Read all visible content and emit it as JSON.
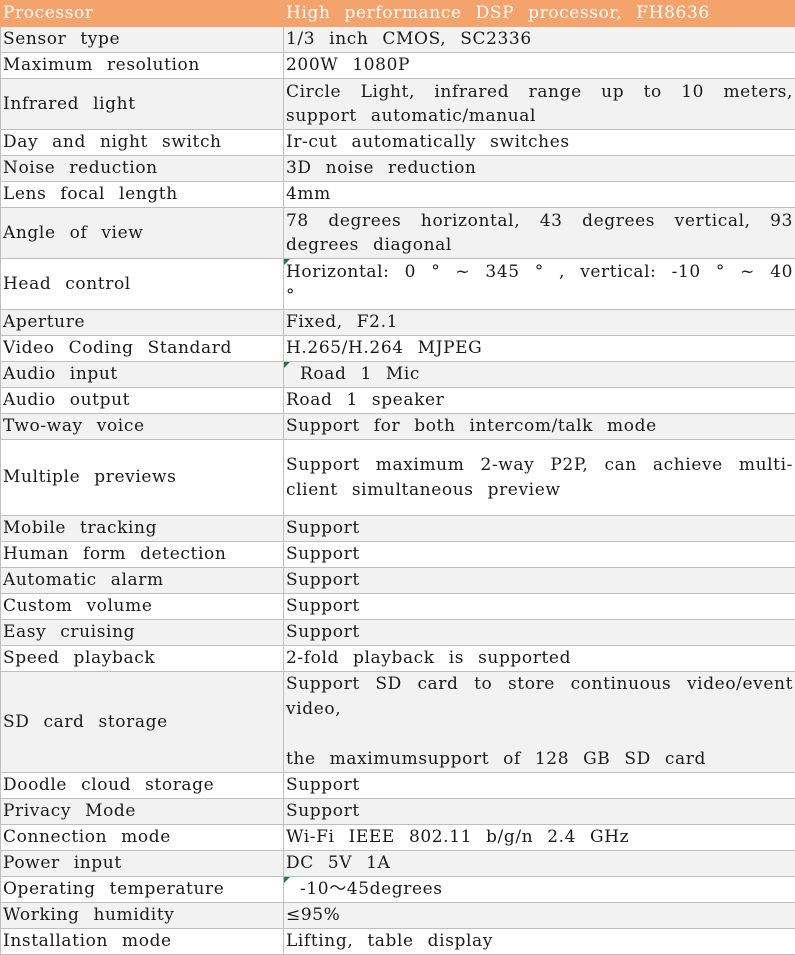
{
  "header": {
    "label": "Processor",
    "value": "High performance DSP processor, FH8636"
  },
  "rows": [
    {
      "label": "Sensor type",
      "value": "1/3 inch CMOS, SC2336"
    },
    {
      "label": "Maximum resolution",
      "value": "200W 1080P"
    },
    {
      "label": "Infrared light",
      "value": "Circle Light, infrared range up to 10 meters, support automatic/manual"
    },
    {
      "label": "Day and night switch",
      "value": "Ir-cut automatically switches"
    },
    {
      "label": "Noise reduction",
      "value": "3D noise reduction"
    },
    {
      "label": "Lens focal length",
      "value": "4mm"
    },
    {
      "label": "Angle of view",
      "value": "78 degrees horizontal, 43 degrees vertical, 93 degrees diagonal"
    },
    {
      "label": "Head control",
      "value": "Horizontal: 0 ° ~ 345 ° , vertical: -10 ° ~ 40 °"
    },
    {
      "label": "Aperture",
      "value": "Fixed, F2.1"
    },
    {
      "label": "Video Coding Standard",
      "value": "H.265/H.264 MJPEG"
    },
    {
      "label": "Audio input",
      "value": " Road 1 Mic"
    },
    {
      "label": "Audio output",
      "value": "Road 1 speaker"
    },
    {
      "label": "Two-way voice",
      "value": "Support for both intercom/talk mode"
    },
    {
      "label": "Multiple previews",
      "value": "Support maximum 2-way P2P, can achieve multi-client simultaneous preview"
    },
    {
      "label": "Mobile tracking",
      "value": "Support"
    },
    {
      "label": "Human form detection",
      "value": "Support"
    },
    {
      "label": "Automatic alarm",
      "value": "Support"
    },
    {
      "label": "Custom volume",
      "value": "Support"
    },
    {
      "label": "Easy cruising",
      "value": "Support"
    },
    {
      "label": "Speed playback",
      "value": "2-fold playback is supported"
    },
    {
      "label": "SD card storage",
      "value": "Support SD card to store continuous video/event video,\n\nthe maximumsupport of 128 GB SD card"
    },
    {
      "label": "Doodle cloud storage",
      "value": "Support"
    },
    {
      "label": "Privacy Mode",
      "value": "Support"
    },
    {
      "label": "Connection mode",
      "value": "Wi-Fi IEEE 802.11 b/g/n 2.4 GHz"
    },
    {
      "label": "Power input",
      "value": "DC 5V 1A"
    },
    {
      "label": "Operating temperature",
      "value": " -10～45degrees"
    },
    {
      "label": "Working humidity",
      "value": "≤95%"
    },
    {
      "label": "Installation mode",
      "value": "Lifting, table display"
    }
  ]
}
